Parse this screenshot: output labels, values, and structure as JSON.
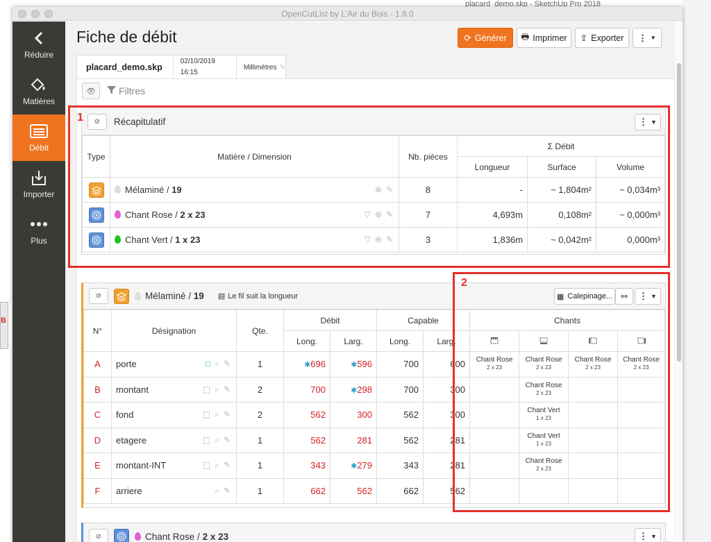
{
  "window": {
    "title": "OpenCutList by L'Air du Bois - 1.8.0",
    "background_title": "placard_demo.skp - SketchUp Pro 2018"
  },
  "sidebar": {
    "items": [
      {
        "label": "Réduire",
        "icon": "chevron-left-icon"
      },
      {
        "label": "Matières",
        "icon": "paint-bucket-icon"
      },
      {
        "label": "Débit",
        "icon": "list-icon",
        "active": true
      },
      {
        "label": "Importer",
        "icon": "import-icon"
      },
      {
        "label": "Plus",
        "icon": "more-icon"
      }
    ]
  },
  "header": {
    "title": "Fiche de débit",
    "buttons": {
      "generate": "Générer",
      "print": "Imprimer",
      "export": "Exporter"
    }
  },
  "file_tab": {
    "name": "placard_demo.skp",
    "date": "02/10/2019 16:15",
    "unit": "Millimètres"
  },
  "filters": {
    "label": "Filtres"
  },
  "summary": {
    "title": "Récapitulatif",
    "headers": {
      "type": "Type",
      "material": "Matière / Dimension",
      "count": "Nb. pièces",
      "sum": "Σ Débit",
      "length": "Longueur",
      "surface": "Surface",
      "volume": "Volume"
    },
    "rows": [
      {
        "material": "Mélaminé",
        "dim": "19",
        "count": "8",
        "length": "-",
        "surface": "~ 1,804m²",
        "volume": "~ 0,034m³",
        "drop_color": "#dddddd",
        "type": "sheet"
      },
      {
        "material": "Chant Rose",
        "dim": "2 x 23",
        "count": "7",
        "length": "4,693m",
        "surface": "0,108m²",
        "volume": "~ 0,000m³",
        "drop_color": "#e060d0",
        "type": "edge"
      },
      {
        "material": "Chant Vert",
        "dim": "1 x 23",
        "count": "3",
        "length": "1,836m",
        "surface": "~ 0,042m²",
        "volume": "0,000m³",
        "drop_color": "#22c022",
        "type": "edge"
      }
    ]
  },
  "group1": {
    "material": "Mélaminé",
    "dim": "19",
    "grain_note": "Le fil suit la longueur",
    "calepinage": "Calepinage...",
    "headers": {
      "num": "N°",
      "designation": "Désignation",
      "qty": "Qte.",
      "debit": "Débit",
      "capable": "Capable",
      "edges": "Chants",
      "long": "Long.",
      "larg": "Larg."
    },
    "rows": [
      {
        "id": "A",
        "name": "porte",
        "qty": "1",
        "d_long": "696",
        "d_long_star": true,
        "d_larg": "596",
        "d_larg_star": true,
        "c_long": "700",
        "c_larg": "600",
        "edges": [
          "Chant Rose",
          "Chant Rose",
          "Chant Rose",
          "Chant Rose"
        ],
        "edge_dims": [
          "2 x 23",
          "2 x 23",
          "2 x 23",
          "2 x 23"
        ]
      },
      {
        "id": "B",
        "name": "montant",
        "qty": "2",
        "d_long": "700",
        "d_long_star": false,
        "d_larg": "298",
        "d_larg_star": true,
        "c_long": "700",
        "c_larg": "300",
        "edges": [
          "",
          "Chant Rose",
          "",
          ""
        ],
        "edge_dims": [
          "",
          "2 x 23",
          "",
          ""
        ]
      },
      {
        "id": "C",
        "name": "fond",
        "qty": "2",
        "d_long": "562",
        "d_long_star": false,
        "d_larg": "300",
        "d_larg_star": false,
        "c_long": "562",
        "c_larg": "300",
        "edges": [
          "",
          "Chant Vert",
          "",
          ""
        ],
        "edge_dims": [
          "",
          "1 x 23",
          "",
          ""
        ]
      },
      {
        "id": "D",
        "name": "etagere",
        "qty": "1",
        "d_long": "562",
        "d_long_star": false,
        "d_larg": "281",
        "d_larg_star": false,
        "c_long": "562",
        "c_larg": "281",
        "edges": [
          "",
          "Chant Vert",
          "",
          ""
        ],
        "edge_dims": [
          "",
          "1 x 23",
          "",
          ""
        ]
      },
      {
        "id": "E",
        "name": "montant-INT",
        "qty": "1",
        "d_long": "343",
        "d_long_star": false,
        "d_larg": "279",
        "d_larg_star": true,
        "c_long": "343",
        "c_larg": "281",
        "edges": [
          "",
          "Chant Rose",
          "",
          ""
        ],
        "edge_dims": [
          "",
          "2 x 23",
          "",
          ""
        ]
      },
      {
        "id": "F",
        "name": "arriere",
        "qty": "1",
        "d_long": "662",
        "d_long_star": false,
        "d_larg": "562",
        "d_larg_star": false,
        "c_long": "662",
        "c_larg": "562",
        "edges": [
          "",
          "",
          "",
          ""
        ],
        "edge_dims": [
          "",
          "",
          "",
          ""
        ]
      }
    ]
  },
  "group2": {
    "material": "Chant Rose",
    "dim": "2 x 23"
  },
  "annotations": {
    "one": "1",
    "two": "2"
  },
  "colors": {
    "accent": "#f0731f",
    "sidebar": "#3b3b35",
    "annotation": "#e5302a",
    "value_red": "#d42222",
    "star_blue": "#2aa0c8"
  }
}
